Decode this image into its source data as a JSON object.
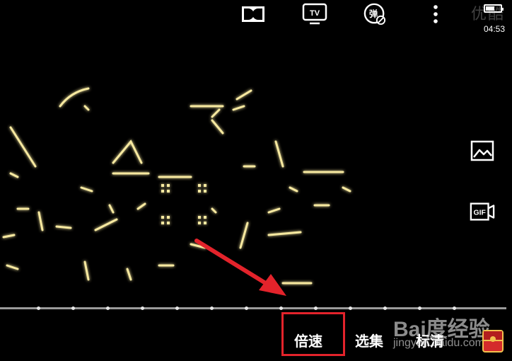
{
  "status_bar": {
    "time": "04:53",
    "battery_level": 0.6
  },
  "watermark_top": "优酷",
  "top_icons": [
    "dolby-icon",
    "tv-cast-icon",
    "danmaku-off-icon",
    "more-vert-icon"
  ],
  "danmaku_label": "弹",
  "tv_label": "TV",
  "side_icons": [
    "screenshot-icon",
    "gif-icon"
  ],
  "gif_label": "GIF",
  "bottom_controls": {
    "speed": "倍速",
    "episodes": "选集",
    "quality": "标清"
  },
  "watermark_baidu": {
    "main": "Bai度经验",
    "sub": "jingyan.baidu.com"
  },
  "colors": {
    "highlight": "#e3232b",
    "glow": "#f7e9a0",
    "progress": "#9a9a9a"
  },
  "progress_markers": 13
}
